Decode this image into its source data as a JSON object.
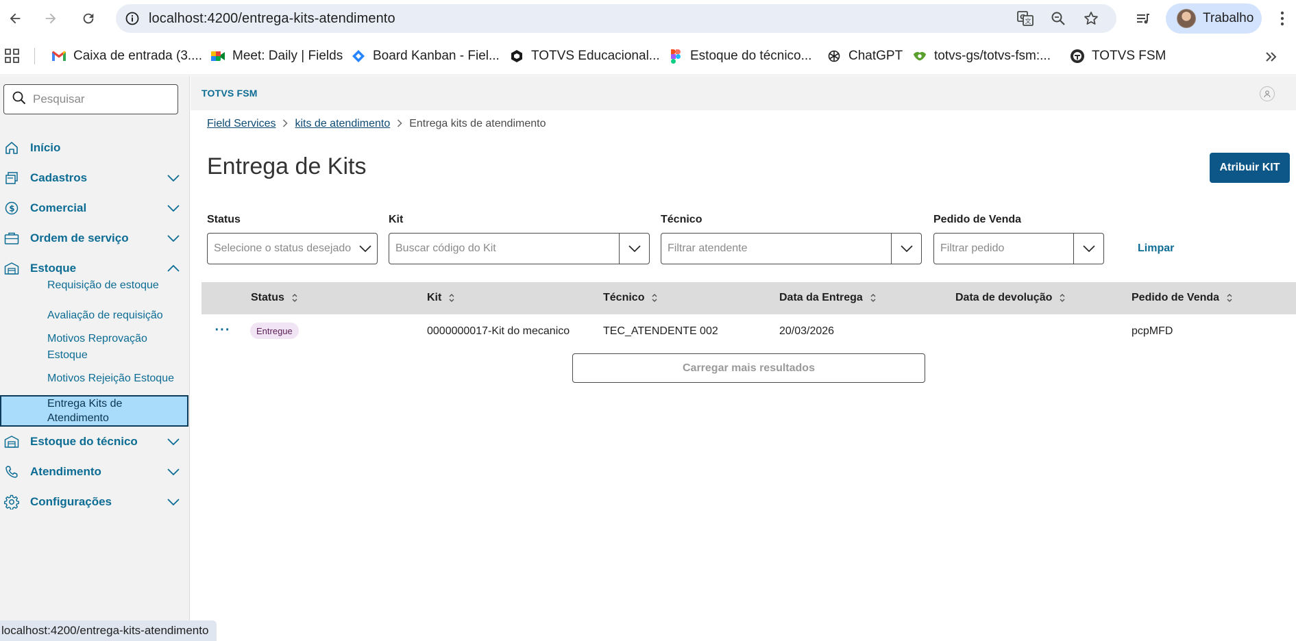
{
  "browser": {
    "url": "localhost:4200/entrega-kits-atendimento",
    "profile_label": "Trabalho",
    "bookmarks": [
      "Caixa de entrada (3....",
      "Meet: Daily | Fields",
      "Board Kanban - Fiel...",
      "TOTVS Educacional...",
      "Estoque do técnico...",
      "ChatGPT",
      "totvs-gs/totvs-fsm:...",
      "TOTVS FSM"
    ],
    "status_url": "localhost:4200/entrega-kits-atendimento"
  },
  "sidebar": {
    "search_placeholder": "Pesquisar",
    "items": [
      {
        "label": "Início",
        "icon": "home-icon"
      },
      {
        "label": "Cadastros",
        "icon": "register-icon"
      },
      {
        "label": "Comercial",
        "icon": "dollar-icon"
      },
      {
        "label": "Ordem de serviço",
        "icon": "briefcase-icon"
      },
      {
        "label": "Estoque",
        "icon": "warehouse-icon"
      },
      {
        "label": "Estoque do técnico",
        "icon": "warehouse-icon"
      },
      {
        "label": "Atendimento",
        "icon": "phone-icon"
      },
      {
        "label": "Configurações",
        "icon": "gear-icon"
      }
    ],
    "estoque_subitems": [
      "Requisição de estoque",
      "Avaliação de requisição",
      "Motivos Reprovação Estoque",
      "Motivos Rejeição Estoque",
      "Entrega Kits de Atendimento"
    ]
  },
  "header": {
    "app_title": "TOTVS FSM"
  },
  "breadcrumb": {
    "items": [
      "Field Services",
      "kits de atendimento"
    ],
    "current": "Entrega kits de atendimento"
  },
  "page": {
    "title": "Entrega de Kits",
    "primary_action": "Atribuir KIT"
  },
  "filters": {
    "status": {
      "label": "Status",
      "placeholder": "Selecione o status desejado"
    },
    "kit": {
      "label": "Kit",
      "placeholder": "Buscar código do Kit"
    },
    "tecnico": {
      "label": "Técnico",
      "placeholder": "Filtrar atendente"
    },
    "pedido": {
      "label": "Pedido de Venda",
      "placeholder": "Filtrar pedido"
    },
    "clear_label": "Limpar"
  },
  "table": {
    "columns": [
      "Status",
      "Kit",
      "Técnico",
      "Data da Entrega",
      "Data de devolução",
      "Pedido de Venda"
    ],
    "rows": [
      {
        "actions": "···",
        "status": "Entregue",
        "kit": "0000000017-Kit do mecanico",
        "tecnico": "TEC_ATENDENTE 002",
        "data_entrega": "20/03/2026",
        "data_devolucao": "",
        "pedido_venda": "pcpMFD"
      }
    ],
    "load_more_label": "Carregar mais resultados"
  },
  "colors": {
    "accent": "#0c6c94",
    "primary_button": "#0c5787",
    "active_menu_bg": "#a8dcfa",
    "badge_bg": "#f1e4f4"
  }
}
